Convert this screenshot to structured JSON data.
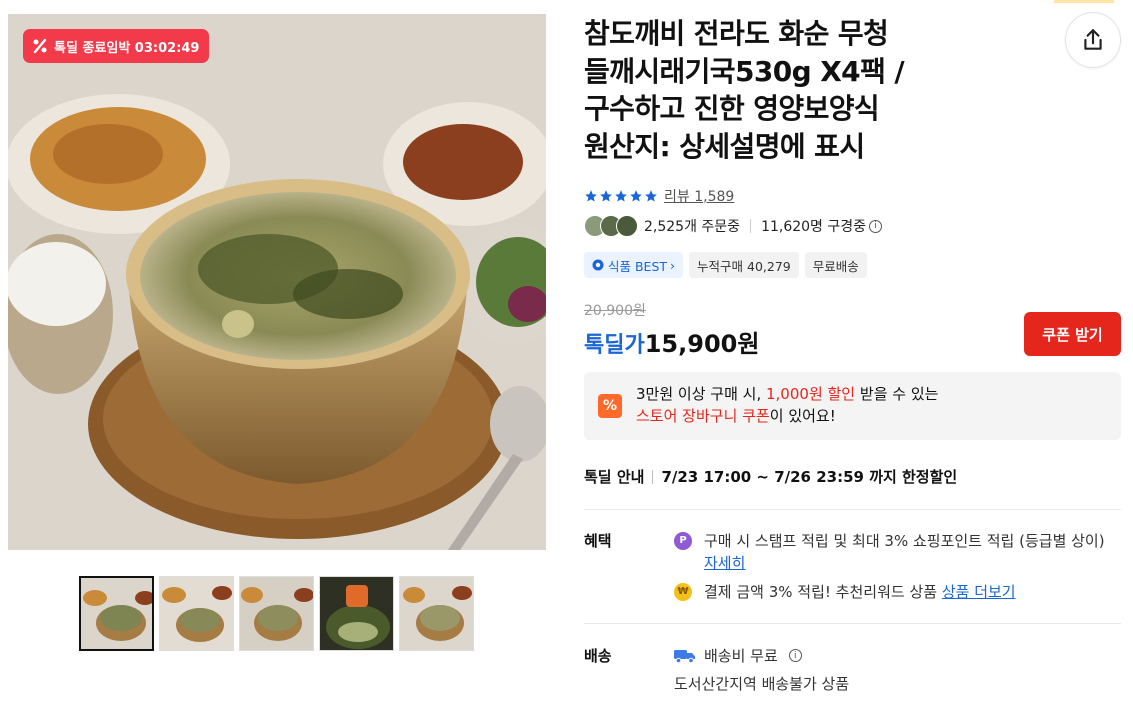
{
  "deal_badge": {
    "label": "톡딜 종료임박 03:02:49",
    "color": "#f23a4a"
  },
  "product": {
    "title_lines": [
      "참도깨비 전라도 화순 무청",
      "들깨시래기국530g X4팩 /",
      "구수하고 진한 영양보양식",
      "원산지: 상세설명에 표시"
    ]
  },
  "rating": {
    "stars": 5,
    "review_label": "리뷰 1,589"
  },
  "stats": {
    "orders": "2,525개 주문중",
    "viewers": "11,620명 구경중",
    "info_glyph": "i"
  },
  "tags": [
    "식품 BEST",
    "누적구매 40,279",
    "무료배송"
  ],
  "price": {
    "original": "20,900원",
    "deal_label": "톡딜가",
    "current": "15,900원",
    "coupon_button": "쿠폰 받기"
  },
  "promo": {
    "icon": "%",
    "line1_a": "3만원 이상 구매 시, ",
    "line1_hl": "1,000원 할인",
    "line1_b": " 받을 수 있는",
    "line2_hl": "스토어 장바구니 쿠폰",
    "line2_b": "이 있어요!"
  },
  "deal_info": {
    "label": "톡딜 안내",
    "value": "7/23 17:00 ~ 7/26 23:59 까지 한정할인"
  },
  "benefits": {
    "label": "혜택",
    "item1_text": "구매 시 스탬프 적립 및 최대 3% 쇼핑포인트 적립 (등급별 상이) ",
    "item1_link": "자세히",
    "item1_icon": "P",
    "item2_text": "결제 금액 3% 적립! 추천리워드 상품 ",
    "item2_link": "상품 더보기",
    "item2_icon": "₩"
  },
  "shipping": {
    "label": "배송",
    "fee": "배송비 무료",
    "note": "도서산간지역 배송불가 상품"
  },
  "thumbnails": [
    "thumb-1",
    "thumb-2",
    "thumb-3",
    "thumb-4",
    "thumb-5"
  ],
  "colors": {
    "accent": "#1a66d6",
    "coupon": "#e5261d",
    "star": "#1a66d6"
  }
}
